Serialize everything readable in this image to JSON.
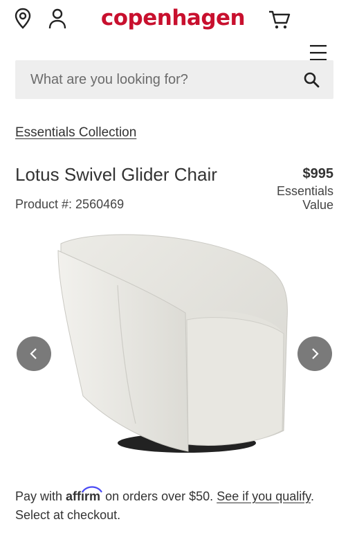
{
  "header": {
    "logo": "copenhagen",
    "icons": [
      "location-pin-icon",
      "account-icon",
      "cart-icon",
      "menu-icon"
    ],
    "brand_color": "#c8102e"
  },
  "search": {
    "placeholder": "What are you looking for?",
    "icon": "search-icon"
  },
  "breadcrumb": "Essentials Collection",
  "product": {
    "title": "Lotus Swivel Glider Chair",
    "product_number": "Product #: 2560469",
    "price": "$995",
    "price_label_line1": "Essentials",
    "price_label_line2": "Value"
  },
  "gallery": {
    "prev_icon": "chevron-left-icon",
    "next_icon": "chevron-right-icon"
  },
  "financing": {
    "prefix": "Pay with",
    "brand": "affirm",
    "suffix": "on orders over $50.",
    "link": "See if you qualify",
    "period": ".",
    "note": "Select at checkout."
  }
}
